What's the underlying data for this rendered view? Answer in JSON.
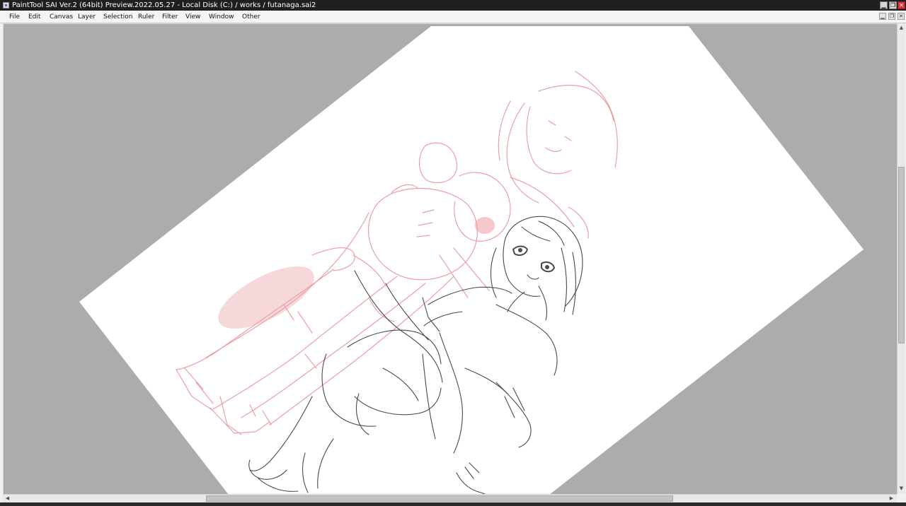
{
  "window": {
    "title": "PaintTool SAI Ver.2 (64bit) Preview.2022.05.27 - Local Disk (C:) / works / futanaga.sai2",
    "controls": {
      "minimize": "▁",
      "restore": "❐",
      "close": "✕"
    }
  },
  "menu": {
    "file": "File",
    "edit": "Edit",
    "canvas": "Canvas",
    "layer": "Layer",
    "selection": "Selection",
    "ruler": "Ruler",
    "filter": "Filter",
    "view": "View",
    "window": "Window",
    "other": "Other"
  },
  "mdi_controls": {
    "minimize": "▁",
    "restore": "❐",
    "close": "✕"
  },
  "scrollbars": {
    "up": "▲",
    "down": "▼",
    "left": "◀",
    "right": "▶"
  },
  "colors": {
    "workspace": "#acacac",
    "paper": "#ffffff",
    "sketch_red": "#e8959b",
    "lineart": "#4a4a4a"
  }
}
